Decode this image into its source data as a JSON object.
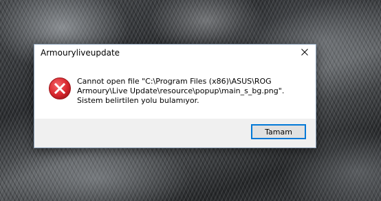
{
  "dialog": {
    "title": "Armouryliveupdate",
    "message": "Cannot open file \"C:\\Program Files (x86)\\ASUS\\ROG Armoury\\Live Update\\resource\\popup\\main_s_bg.png\". Sistem belirtilen yolu bulamıyor.",
    "ok_label": "Tamam",
    "icon": "error-icon",
    "close_icon": "close-icon"
  },
  "colors": {
    "error_red": "#d9272e",
    "button_focus": "#0078d7",
    "footer_bg": "#f0f0f0"
  }
}
